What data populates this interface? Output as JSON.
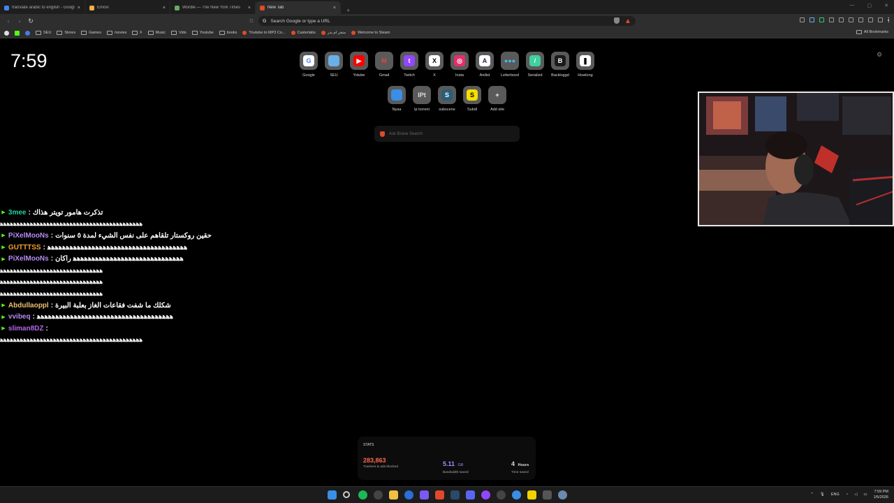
{
  "tabs": [
    {
      "title": "translate arabic to english - Google",
      "color": "#4285f4"
    },
    {
      "title": "Emovi",
      "color": "#f0b040"
    },
    {
      "title": "Wordle — The New York Times",
      "color": "#6aaa64"
    },
    {
      "title": "New Tab",
      "color": "#e04a2a"
    }
  ],
  "new_tab_symbol": "+",
  "address_bar": {
    "placeholder": "Search Google or type a URL"
  },
  "bookmarks": [
    {
      "label": "SEU",
      "kind": "folder"
    },
    {
      "label": "Stores",
      "kind": "folder"
    },
    {
      "label": "Games",
      "kind": "folder"
    },
    {
      "label": "movies",
      "kind": "folder"
    },
    {
      "label": "F",
      "kind": "folder"
    },
    {
      "label": "Music",
      "kind": "folder"
    },
    {
      "label": "Vids",
      "kind": "folder"
    },
    {
      "label": "Youtube",
      "kind": "folder"
    },
    {
      "label": "books",
      "kind": "folder"
    },
    {
      "label": "Youtube to MP3 Co...",
      "kind": "site"
    },
    {
      "label": "Casterlabs",
      "kind": "site"
    },
    {
      "label": "متجر ام بدر",
      "kind": "site"
    },
    {
      "label": "Welcome to Steam",
      "kind": "site"
    }
  ],
  "all_bookmarks": "All Bookmarks",
  "clock": "7:59",
  "top_sites": [
    {
      "label": "Google",
      "glyph": "G",
      "bg": "#ffffff",
      "fg": "#4285f4"
    },
    {
      "label": "SEU",
      "glyph": "",
      "bg": "#6ab0e8",
      "fg": "#fff"
    },
    {
      "label": "Yotube",
      "glyph": "▶",
      "bg": "#ff0000",
      "fg": "#fff"
    },
    {
      "label": "Gmail",
      "glyph": "M",
      "bg": "#5a5a5a",
      "fg": "#ea4335"
    },
    {
      "label": "Twitch",
      "glyph": "t",
      "bg": "#9146ff",
      "fg": "#fff"
    },
    {
      "label": "X",
      "glyph": "X",
      "bg": "#ffffff",
      "fg": "#000"
    },
    {
      "label": "Insta",
      "glyph": "◎",
      "bg": "#e1306c",
      "fg": "#fff"
    },
    {
      "label": "Anilist",
      "glyph": "A",
      "bg": "#ffffff",
      "fg": "#1b2538"
    },
    {
      "label": "Letterboxd",
      "glyph": "●●●",
      "bg": "#5a5a5a",
      "fg": "#40bcf4"
    },
    {
      "label": "Serializd",
      "glyph": "/",
      "bg": "#3fd1a0",
      "fg": "#fff"
    },
    {
      "label": "Backloggd",
      "glyph": "B",
      "bg": "#1a1a1a",
      "fg": "#fff"
    },
    {
      "label": "Howlong",
      "glyph": "❚",
      "bg": "#ffffff",
      "fg": "#000"
    },
    {
      "label": "Nyaa",
      "glyph": "",
      "bg": "#3a8ee6",
      "fg": "#fff"
    },
    {
      "label": "Ip torrent",
      "glyph": "IPt",
      "bg": "#5a5a5a",
      "fg": "#ddd"
    },
    {
      "label": "subscene",
      "glyph": "S",
      "bg": "#2a5e7a",
      "fg": "#fff"
    },
    {
      "label": "Subdl",
      "glyph": "S",
      "bg": "#f5e000",
      "fg": "#000"
    },
    {
      "label": "Add site",
      "glyph": "+",
      "bg": "#5a5a5a",
      "fg": "#fff"
    }
  ],
  "search": {
    "placeholder": "Ask Brave Search"
  },
  "chat": [
    {
      "user": "3mee",
      "color": "#19d6a0",
      "msg": "تذكرت هامور تويتر هذاك"
    },
    {
      "spam": "ﻫﻫﻫﻫﻫﻫﻫﻫﻫﻫﻫﻫﻫﻫﻫﻫﻫﻫﻫﻫﻫﻫﻫﻫﻫﻫﻫﻫﻫﻫﻫﻫﻫﻫﻫﻫﻫﻫﻫﻫﻫﻫﻫ"
    },
    {
      "user": "PiXelMooNs",
      "color": "#b68cf0",
      "msg": "حقين روكستار تلقاهم على نفس الشيء لمدة ٥ سنوات"
    },
    {
      "user": "GUTTTSS",
      "color": "#f0a030",
      "msg": "ﻫﻫﻫﻫﻫﻫﻫﻫﻫﻫﻫﻫﻫﻫﻫﻫﻫﻫﻫﻫﻫﻫﻫﻫﻫﻫﻫﻫﻫﻫﻫﻫﻫﻫﻫﻫﻫﻫ"
    },
    {
      "user": "PiXelMooNs",
      "color": "#b68cf0",
      "msg": "ﻫﻫﻫﻫﻫﻫﻫﻫﻫﻫﻫﻫﻫﻫﻫﻫﻫﻫﻫﻫﻫﻫﻫﻫﻫﻫﻫﻫﻫﻫ راكان"
    },
    {
      "spam": "ﻫﻫﻫﻫﻫﻫﻫﻫﻫﻫﻫﻫﻫﻫﻫﻫﻫﻫﻫﻫﻫﻫﻫﻫﻫﻫﻫﻫﻫﻫﻫ"
    },
    {
      "spam": "ﻫﻫﻫﻫﻫﻫﻫﻫﻫﻫﻫﻫﻫﻫﻫﻫﻫﻫﻫﻫﻫﻫﻫﻫﻫﻫﻫﻫﻫﻫﻫ"
    },
    {
      "spam": "ﻫﻫﻫﻫﻫﻫﻫﻫﻫﻫﻫﻫﻫﻫﻫﻫﻫﻫﻫﻫﻫﻫﻫﻫﻫﻫﻫﻫﻫﻫﻫ"
    },
    {
      "user": "Abdullaoppl",
      "color": "#f0c070",
      "msg": "شكلك ما شفت فقاعات الغاز بعلبة البيرة"
    },
    {
      "user": "vvibeq",
      "color": "#b68cf0",
      "msg": "ﻫﻫﻫﻫﻫﻫﻫﻫﻫﻫﻫﻫﻫﻫﻫﻫﻫﻫﻫﻫﻫﻫﻫﻫﻫﻫﻫﻫﻫﻫﻫﻫﻫﻫﻫﻫﻫ"
    },
    {
      "user": "sliman8DZ",
      "color": "#b068e8",
      "msg": ""
    },
    {
      "spam": "ﻫﻫﻫﻫﻫﻫﻫﻫﻫﻫﻫﻫﻫﻫﻫﻫﻫﻫﻫﻫﻫﻫﻫﻫﻫﻫﻫﻫﻫﻫﻫﻫﻫﻫﻫﻫﻫﻫﻫﻫﻫﻫﻫ"
    }
  ],
  "stats": {
    "heading": "STATS",
    "trackers": {
      "value": "283,863",
      "label": "Trackers & ads blocked",
      "color": "#ff6a4a"
    },
    "bandwidth": {
      "value": "5.11",
      "unit": "GB",
      "label": "Bandwidth saved",
      "color": "#9b8cff"
    },
    "time": {
      "value": "4",
      "unit": "Hours",
      "label": "Time saved",
      "color": "#ffffff"
    }
  },
  "tray": {
    "lang": "ENG",
    "time": "7:59 PM",
    "date": "1/5/2026"
  },
  "accent": "#e04a2a"
}
